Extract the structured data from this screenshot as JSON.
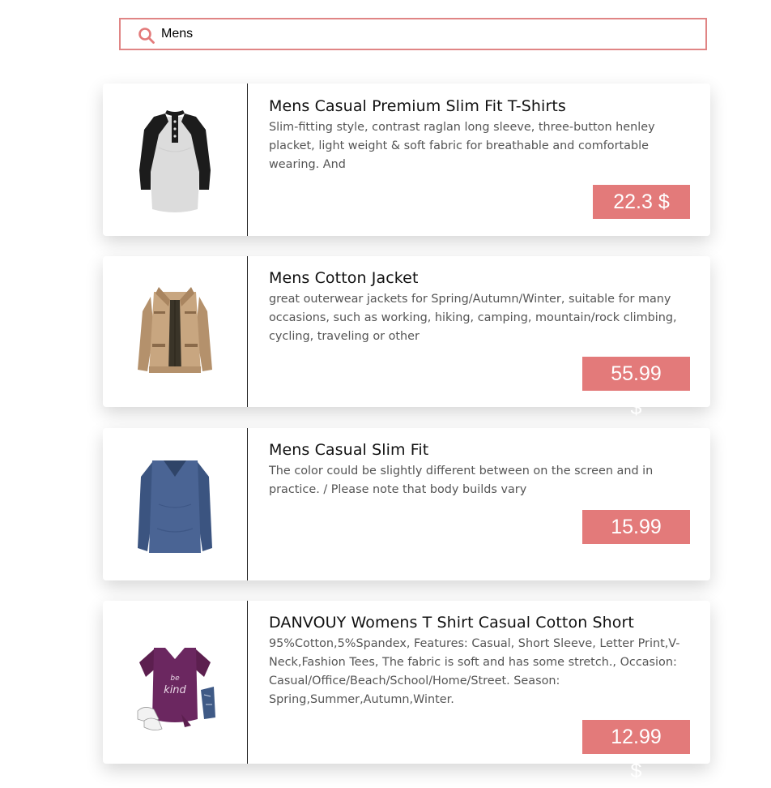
{
  "search": {
    "value": "Mens",
    "icon": "search-icon"
  },
  "colors": {
    "accent": "#e37a7a",
    "search_border": "#e08585"
  },
  "products": [
    {
      "title": "Mens Casual Premium Slim Fit T-Shirts",
      "description": "Slim-fitting style, contrast raglan long sleeve, three-button henley placket, light weight & soft fabric for breathable and comfortable wearing. And",
      "price": "22.3 $",
      "image": "raglan-henley-shirt"
    },
    {
      "title": "Mens Cotton Jacket",
      "description": "great outerwear jackets for Spring/Autumn/Winter, suitable for many occasions, such as working, hiking, camping, mountain/rock climbing, cycling, traveling or other",
      "price": "55.99 $",
      "image": "khaki-jacket"
    },
    {
      "title": "Mens Casual Slim Fit",
      "description": "The color could be slightly different between on the screen and in practice. / Please note that body builds vary",
      "price": "15.99 $",
      "image": "blue-long-sleeve-shirt"
    },
    {
      "title": "DANVOUY Womens T Shirt Casual Cotton Short",
      "description": "95%Cotton,5%Spandex, Features: Casual, Short Sleeve, Letter Print,V-Neck,Fashion Tees, The fabric is soft and has some stretch., Occasion: Casual/Office/Beach/School/Home/Street. Season: Spring,Summer,Autumn,Winter.",
      "price": "12.99 $",
      "image": "purple-print-tshirt",
      "image_text": "be kind"
    }
  ]
}
